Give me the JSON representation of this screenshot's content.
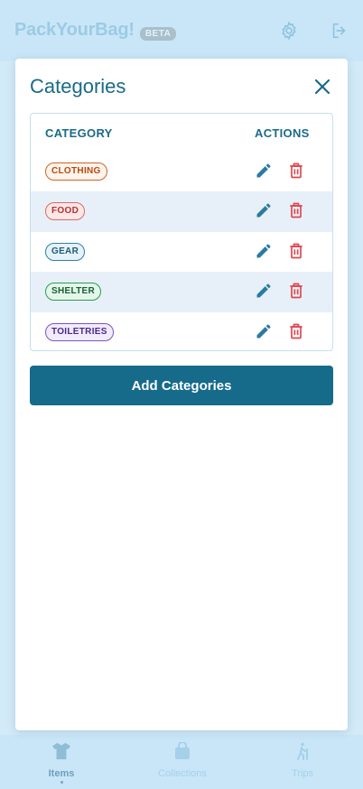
{
  "app": {
    "brand": "PackYourBag!",
    "badge": "BETA"
  },
  "header": {
    "settings_icon": "gear-icon",
    "logout_icon": "logout-icon"
  },
  "modal": {
    "title": "Categories",
    "close_icon": "close-icon",
    "table": {
      "headers": {
        "category": "CATEGORY",
        "actions": "ACTIONS"
      },
      "rows": [
        {
          "label": "CLOTHING"
        },
        {
          "label": "FOOD"
        },
        {
          "label": "GEAR"
        },
        {
          "label": "SHELTER"
        },
        {
          "label": "TOILETRIES"
        }
      ]
    },
    "add_button": "Add Categories"
  },
  "bottom_nav": {
    "items": [
      {
        "label": "Items",
        "icon": "shirt-icon",
        "active": true
      },
      {
        "label": "Collections",
        "icon": "bag-icon",
        "active": false
      },
      {
        "label": "Trips",
        "icon": "hiker-icon",
        "active": false
      }
    ]
  },
  "colors": {
    "primary": "#166b8a",
    "delete": "#e0464e",
    "clothing": "#b84a0e",
    "food": "#d23a3a",
    "gear": "#1a5c7a",
    "shelter": "#17763a",
    "toiletries": "#5b32a8"
  }
}
